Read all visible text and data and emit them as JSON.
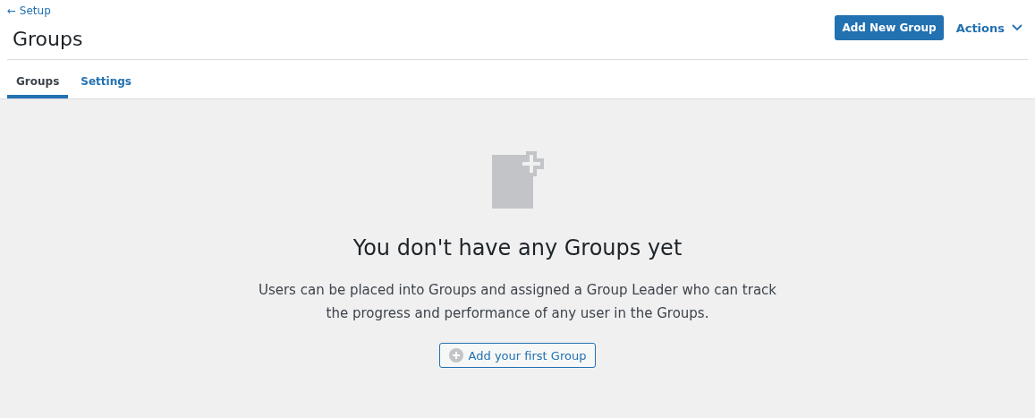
{
  "back_link": "← Setup",
  "title": "Groups",
  "header_buttons": {
    "primary": "Add New Group",
    "actions": "Actions"
  },
  "tabs": [
    {
      "label": "Groups",
      "selected": true
    },
    {
      "label": "Settings",
      "selected": false
    }
  ],
  "empty_state": {
    "heading": "You don't have any Groups yet",
    "description": "Users can be placed into Groups and assigned a Group Leader who can track the progress and performance of any user in the Groups.",
    "button": "Add your first Group"
  }
}
